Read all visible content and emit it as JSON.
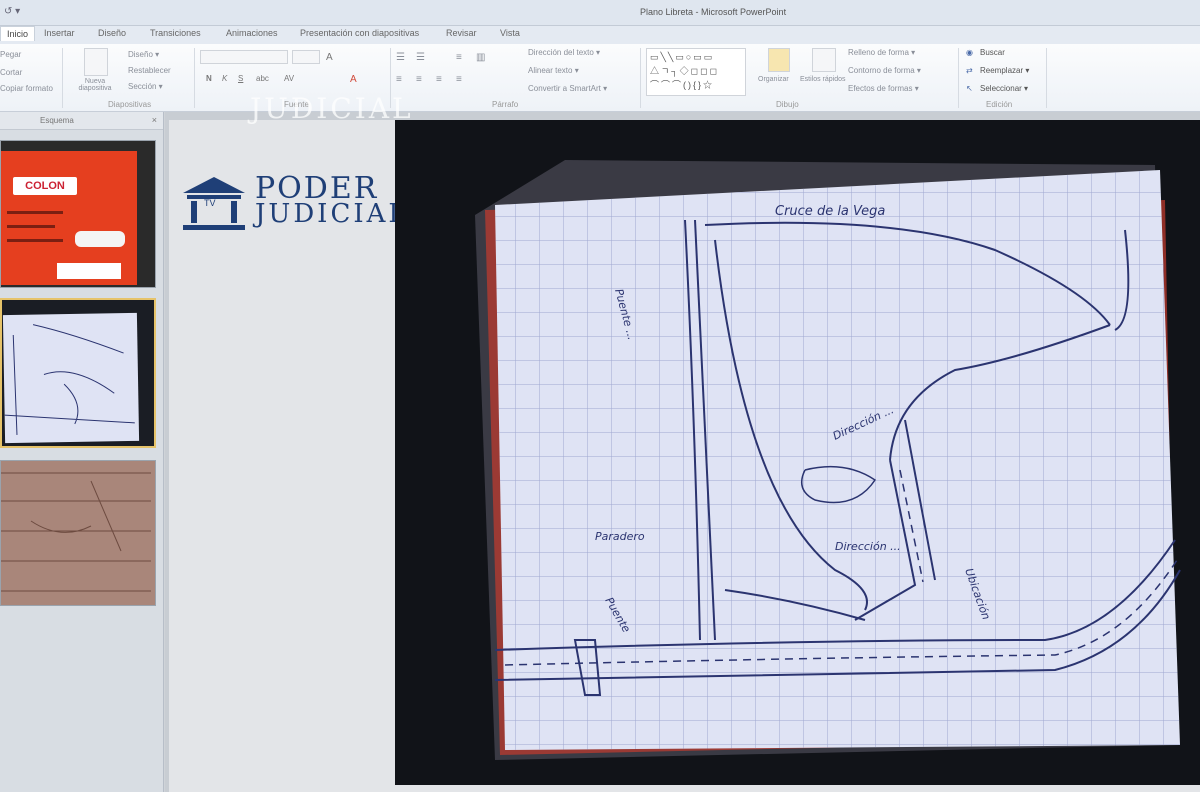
{
  "window": {
    "title": "Plano Libreta - Microsoft PowerPoint",
    "quick_access": "↺ ▾"
  },
  "tabs": [
    "Inicio",
    "Insertar",
    "Diseño",
    "Transiciones",
    "Animaciones",
    "Presentación con diapositivas",
    "Revisar",
    "Vista"
  ],
  "ribbon": {
    "clipboard": [
      "Pegar",
      "Cortar",
      "Copiar formato"
    ],
    "new_slide": "Nueva diapositiva",
    "slides_menu": [
      "Diseño ▾",
      "Restablecer",
      "Sección ▾"
    ],
    "group_slides": "Diapositivas",
    "group_font": "Fuente",
    "group_paragraph": "Párrafo",
    "paragraph_items": [
      "Dirección del texto ▾",
      "Alinear texto ▾",
      "Convertir a SmartArt ▾"
    ],
    "group_drawing": "Dibujo",
    "arrange": "Organizar",
    "quick_styles": "Estilos rápidos",
    "shape_items": [
      "Relleno de forma ▾",
      "Contorno de forma ▾",
      "Efectos de formas ▾"
    ],
    "group_editing": "Edición",
    "editing_items": [
      "Buscar",
      "Reemplazar ▾",
      "Seleccionar ▾"
    ]
  },
  "panel": {
    "tab_label": "Esquema",
    "close": "×"
  },
  "thumbnails": [
    {
      "label": "COLON",
      "state": "normal"
    },
    {
      "label": "",
      "state": "selected"
    },
    {
      "label": "",
      "state": "normal"
    }
  ],
  "slide": {
    "logo_line1": "PODER",
    "logo_line2": "JUDICIAL",
    "logo_emblem": "TV",
    "watermark": "JUDICIAL"
  },
  "sketch": {
    "labels": [
      "Cruce de la Vega",
      "Dirección ...",
      "Puente ...",
      "Dirección ...",
      "Paradero",
      "Puente",
      "Ubicación"
    ],
    "paper_color": "#dfe3f4",
    "ink_color": "#2b3470",
    "background_color": "#111318"
  },
  "colors": {
    "accent": "#1f3f77",
    "thumb_orange": "#e53f1f",
    "selection": "#e6c36a"
  }
}
